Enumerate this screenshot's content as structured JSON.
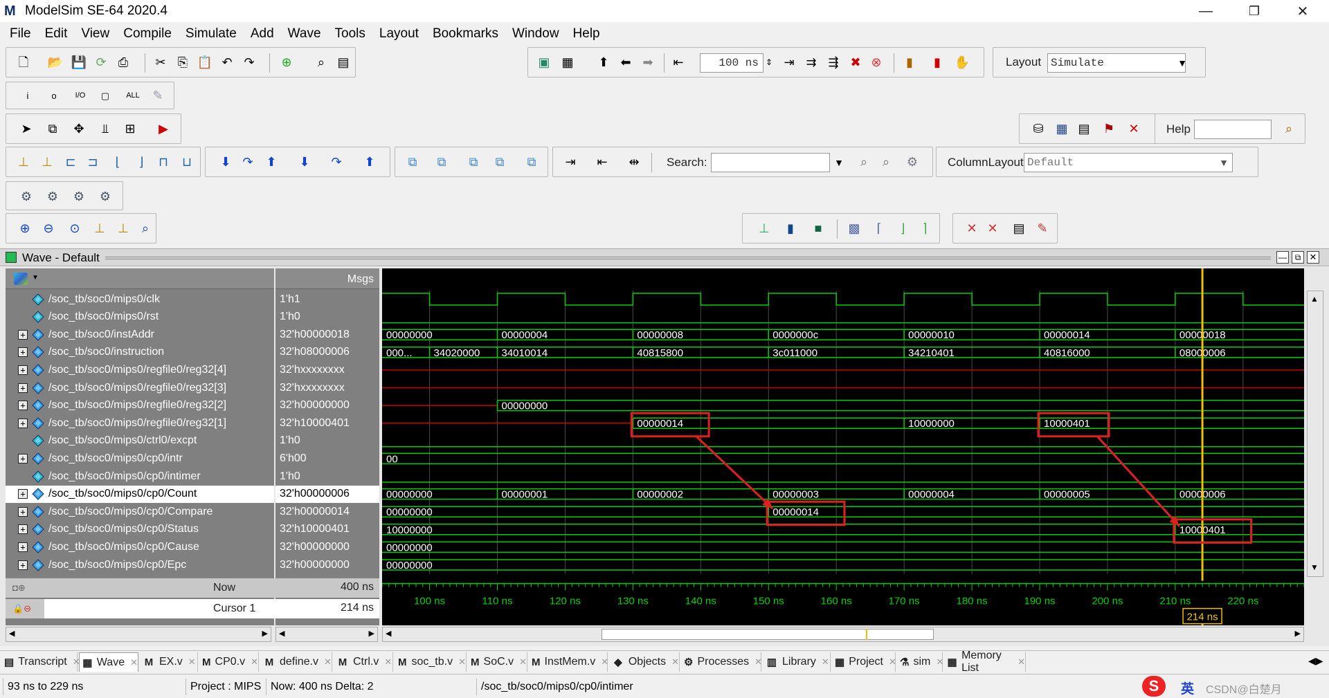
{
  "window": {
    "title": "ModelSim SE-64 2020.4",
    "app_icon": "M",
    "minimize": "—",
    "maximize": "❐",
    "close": "✕"
  },
  "menu": [
    "File",
    "Edit",
    "View",
    "Compile",
    "Simulate",
    "Add",
    "Wave",
    "Tools",
    "Layout",
    "Bookmarks",
    "Window",
    "Help"
  ],
  "toolbar": {
    "run_length": "100 ns",
    "layout_label": "Layout",
    "layout_value": "Simulate",
    "help_label": "Help",
    "help_value": "",
    "search_label": "Search:",
    "search_value": "",
    "column_layout_label": "ColumnLayout",
    "column_layout_value": "Default"
  },
  "wave": {
    "panel_title": "Wave - Default",
    "msgs_header": "Msgs",
    "signals": [
      {
        "name": "/soc_tb/soc0/mips0/clk",
        "value": "1'h1",
        "expand": false
      },
      {
        "name": "/soc_tb/soc0/mips0/rst",
        "value": "1'h0",
        "expand": false
      },
      {
        "name": "/soc_tb/soc0/instAddr",
        "value": "32'h00000018",
        "expand": true
      },
      {
        "name": "/soc_tb/soc0/instruction",
        "value": "32'h08000006",
        "expand": true
      },
      {
        "name": "/soc_tb/soc0/mips0/regfile0/reg32[4]",
        "value": "32'hxxxxxxxx",
        "expand": true
      },
      {
        "name": "/soc_tb/soc0/mips0/regfile0/reg32[3]",
        "value": "32'hxxxxxxxx",
        "expand": true
      },
      {
        "name": "/soc_tb/soc0/mips0/regfile0/reg32[2]",
        "value": "32'h00000000",
        "expand": true
      },
      {
        "name": "/soc_tb/soc0/mips0/regfile0/reg32[1]",
        "value": "32'h10000401",
        "expand": true
      },
      {
        "name": "/soc_tb/soc0/mips0/ctrl0/excpt",
        "value": "1'h0",
        "expand": false
      },
      {
        "name": "/soc_tb/soc0/mips0/cp0/intr",
        "value": "6'h00",
        "expand": true
      },
      {
        "name": "/soc_tb/soc0/mips0/cp0/intimer",
        "value": "1'h0",
        "expand": false
      },
      {
        "name": "/soc_tb/soc0/mips0/cp0/Count",
        "value": "32'h00000006",
        "expand": true,
        "selected": true
      },
      {
        "name": "/soc_tb/soc0/mips0/cp0/Compare",
        "value": "32'h00000014",
        "expand": true
      },
      {
        "name": "/soc_tb/soc0/mips0/cp0/Status",
        "value": "32'h10000401",
        "expand": true
      },
      {
        "name": "/soc_tb/soc0/mips0/cp0/Cause",
        "value": "32'h00000000",
        "expand": true
      },
      {
        "name": "/soc_tb/soc0/mips0/cp0/Epc",
        "value": "32'h00000000",
        "expand": true
      }
    ],
    "now_label": "Now",
    "now_value": "400 ns",
    "cursor_label": "Cursor 1",
    "cursor_value": "214 ns",
    "time_range": [
      93,
      229
    ],
    "cursor_time": 214,
    "ticks": [
      "100 ns",
      "110 ns",
      "120 ns",
      "130 ns",
      "140 ns",
      "150 ns",
      "160 ns",
      "170 ns",
      "180 ns",
      "190 ns",
      "200 ns",
      "210 ns",
      "220 ns"
    ],
    "tick_times": [
      100,
      110,
      120,
      130,
      140,
      150,
      160,
      170,
      180,
      190,
      200,
      210,
      220
    ],
    "cursor_marker": "214 ns",
    "clk_edges": [
      100,
      110,
      120,
      130,
      140,
      150,
      160,
      170,
      180,
      190,
      200,
      210,
      220
    ],
    "buses": [
      {
        "row": 2,
        "color": "green",
        "segments": [
          {
            "t": 93,
            "v": "00000000"
          },
          {
            "t": 110,
            "v": "00000004"
          },
          {
            "t": 130,
            "v": "00000008"
          },
          {
            "t": 150,
            "v": "0000000c"
          },
          {
            "t": 170,
            "v": "00000010"
          },
          {
            "t": 190,
            "v": "00000014"
          },
          {
            "t": 210,
            "v": "00000018"
          }
        ]
      },
      {
        "row": 3,
        "color": "green",
        "segments": [
          {
            "t": 93,
            "v": "000..."
          },
          {
            "t": 100,
            "v": "34020000"
          },
          {
            "t": 110,
            "v": "34010014"
          },
          {
            "t": 130,
            "v": "40815800"
          },
          {
            "t": 150,
            "v": "3c011000"
          },
          {
            "t": 170,
            "v": "34210401"
          },
          {
            "t": 190,
            "v": "40816000"
          },
          {
            "t": 210,
            "v": "08000006"
          }
        ]
      },
      {
        "row": 4,
        "color": "red",
        "segments": [
          {
            "t": 93,
            "v": ""
          }
        ]
      },
      {
        "row": 5,
        "color": "red",
        "segments": [
          {
            "t": 93,
            "v": ""
          }
        ]
      },
      {
        "row": 6,
        "color": "mixed",
        "segments": [
          {
            "t": 93,
            "v": ""
          },
          {
            "t": 110,
            "v": "00000000"
          }
        ]
      },
      {
        "row": 7,
        "color": "mixed",
        "segments": [
          {
            "t": 93,
            "v": ""
          },
          {
            "t": 130,
            "v": "00000014"
          },
          {
            "t": 170,
            "v": "10000000"
          },
          {
            "t": 190,
            "v": "10000401"
          }
        ]
      },
      {
        "row": 9,
        "color": "green",
        "segments": [
          {
            "t": 93,
            "v": "00"
          }
        ]
      },
      {
        "row": 11,
        "color": "green",
        "segments": [
          {
            "t": 93,
            "v": "00000000"
          },
          {
            "t": 110,
            "v": "00000001"
          },
          {
            "t": 130,
            "v": "00000002"
          },
          {
            "t": 150,
            "v": "00000003"
          },
          {
            "t": 170,
            "v": "00000004"
          },
          {
            "t": 190,
            "v": "00000005"
          },
          {
            "t": 210,
            "v": "00000006"
          }
        ]
      },
      {
        "row": 12,
        "color": "green",
        "segments": [
          {
            "t": 93,
            "v": "00000000"
          },
          {
            "t": 150,
            "v": "00000014"
          }
        ]
      },
      {
        "row": 13,
        "color": "green",
        "segments": [
          {
            "t": 93,
            "v": "10000000"
          },
          {
            "t": 210,
            "v": "10000401"
          }
        ]
      },
      {
        "row": 14,
        "color": "green",
        "segments": [
          {
            "t": 93,
            "v": "00000000"
          }
        ]
      },
      {
        "row": 15,
        "color": "green",
        "segments": [
          {
            "t": 93,
            "v": "00000000"
          }
        ]
      }
    ],
    "annotations": [
      {
        "row": 7,
        "t0": 130,
        "t1": 141,
        "label": "00000014"
      },
      {
        "row": 12,
        "t0": 150,
        "t1": 161,
        "label": "00000014"
      },
      {
        "row": 7,
        "t0": 190,
        "t1": 200,
        "label": "10000401"
      },
      {
        "row": 13,
        "t0": 210,
        "t1": 221,
        "label": "10000401"
      }
    ]
  },
  "tabs": [
    {
      "label": "Transcript",
      "icon": "transcript-icon"
    },
    {
      "label": "Wave",
      "icon": "wave-icon",
      "active": true
    },
    {
      "label": "EX.v",
      "icon": "m-icon"
    },
    {
      "label": "CP0.v",
      "icon": "m-icon"
    },
    {
      "label": "define.v",
      "icon": "m-icon"
    },
    {
      "label": "Ctrl.v",
      "icon": "m-icon"
    },
    {
      "label": "soc_tb.v",
      "icon": "m-icon"
    },
    {
      "label": "SoC.v",
      "icon": "m-icon"
    },
    {
      "label": "InstMem.v",
      "icon": "m-icon"
    },
    {
      "label": "Objects",
      "icon": "objects-icon"
    },
    {
      "label": "Processes",
      "icon": "processes-icon"
    },
    {
      "label": "Library",
      "icon": "library-icon"
    },
    {
      "label": "Project",
      "icon": "project-icon"
    },
    {
      "label": "sim",
      "icon": "sim-icon"
    },
    {
      "label": "Memory List",
      "icon": "memory-icon"
    }
  ],
  "status": {
    "range": "93 ns to 229 ns",
    "project": "Project : MIPS",
    "now": "Now: 400 ns  Delta: 2",
    "path": "/soc_tb/soc0/mips0/cp0/intimer",
    "ime": "英",
    "watermark": "CSDN@白楚月"
  },
  "colors": {
    "wave_green": "#00d000",
    "wave_red": "#cc0000",
    "cursor": "#f0c000",
    "annot": "#e02020"
  }
}
